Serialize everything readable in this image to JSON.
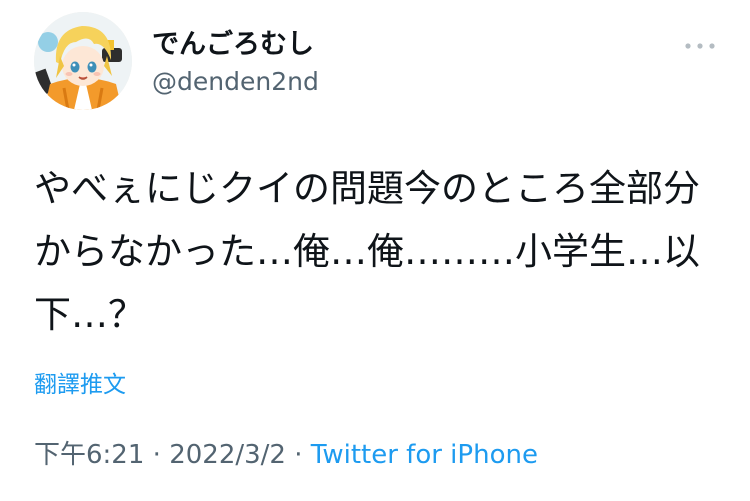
{
  "tweet": {
    "display_name": "でんごろむし",
    "handle": "@denden2nd",
    "text": "やべぇにじクイの問題今のところ全部分からなかった…俺…俺………小学生…以下…？",
    "translate_label": "翻譯推文",
    "time": "下午6:21",
    "separator": " · ",
    "date": "2022/3/2",
    "source": "Twitter for iPhone"
  },
  "icons": {
    "more": "more-horizontal-icon",
    "avatar": "avatar-illustration"
  },
  "colors": {
    "text": "#0f1419",
    "secondary": "#536471",
    "link": "#1d9bf0",
    "background": "#ffffff"
  }
}
